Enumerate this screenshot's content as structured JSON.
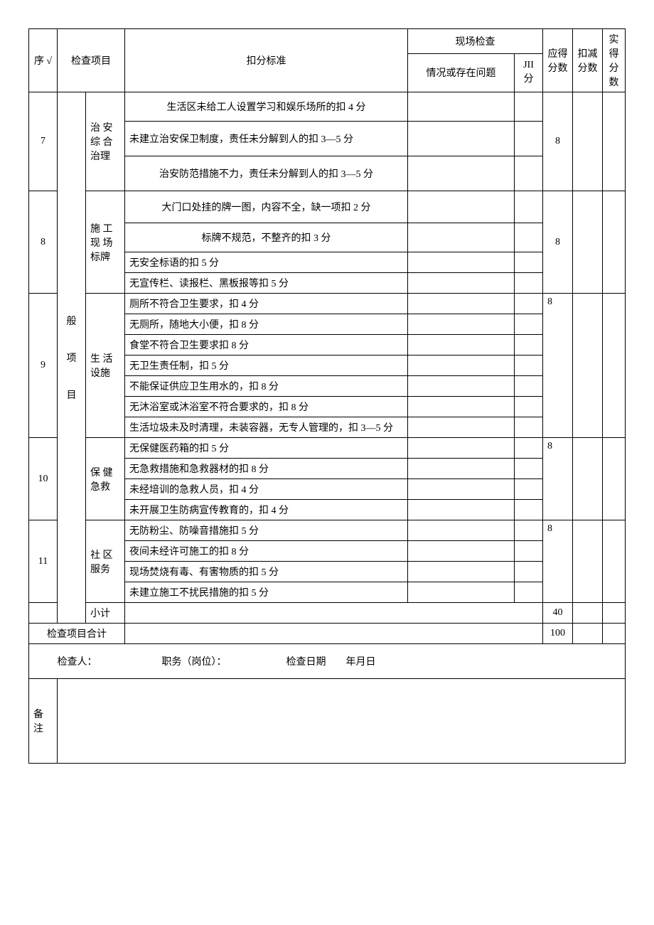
{
  "header": {
    "seq": "序 √",
    "item": "检查项目",
    "standard": "扣分标准",
    "site_check": "现场检查",
    "situation": "情况或存在问题",
    "jfen": "JII 分",
    "ying_de": "应得分数",
    "kou_jian": "扣减分数",
    "shi_de": "实得分数"
  },
  "category": "般",
  "category2": "项",
  "category3": "目",
  "rows": {
    "r7": {
      "seq": "7",
      "sub": "治 安 综 合 治理",
      "lines": [
        "生活区未给工人设置学习和娱乐场所的扣 4 分",
        "未建立治安保卫制度，责任未分解到人的扣 3—5 分",
        "治安防范措施不力，责任未分解到人的扣 3—5 分"
      ],
      "yd": "8"
    },
    "r8": {
      "seq": "8",
      "sub": "施 工 现 场 标牌",
      "lines": [
        "大门口处挂的牌一图，内容不全，缺一项扣 2 分",
        "标牌不规范，不整齐的扣 3 分",
        "无安全标语的扣 5 分",
        "无宣传栏、读报栏、黑板报等扣 5 分"
      ],
      "yd": "8"
    },
    "r9": {
      "seq": "9",
      "sub": "生 活 设施",
      "lines": [
        "厕所不符合卫生要求，扣 4 分",
        "无厕所，随地大小便，扣 8 分",
        "食堂不符合卫生要求扣 8 分",
        "无卫生责任制，扣 5 分",
        "不能保证供应卫生用水的，扣 8 分",
        "无沐浴室或沐浴室不符合要求的，扣 8 分",
        "生活垃圾未及时清理，未装容器，无专人管理的，扣 3—5 分"
      ],
      "yd": "8"
    },
    "r10": {
      "seq": "10",
      "sub": "保 健 急救",
      "lines": [
        "无保健医药箱的扣 5 分",
        "无急救措施和急救器材的扣 8 分",
        "未经培训的急救人员，扣 4 分",
        "未开展卫生防病宣传教育的，扣 4 分"
      ],
      "yd": "8"
    },
    "r11": {
      "seq": "11",
      "sub": "社 区 服务",
      "lines": [
        "无防粉尘、防噪音措施扣 5 分",
        "夜间未经许可施工的扣 8 分",
        "现场焚烧有毒、有害物质的扣 5 分",
        "未建立施工不扰民措施的扣 5 分"
      ],
      "yd": "8"
    }
  },
  "subtotal": {
    "label": "小计",
    "yd": "40"
  },
  "total": {
    "label": "检查项目合计",
    "yd": "100"
  },
  "signature": {
    "inspector": "检查人：",
    "position": "职务（岗位）：",
    "date_label": "检查日期",
    "date_value": "年月日"
  },
  "remark_label": "备注"
}
